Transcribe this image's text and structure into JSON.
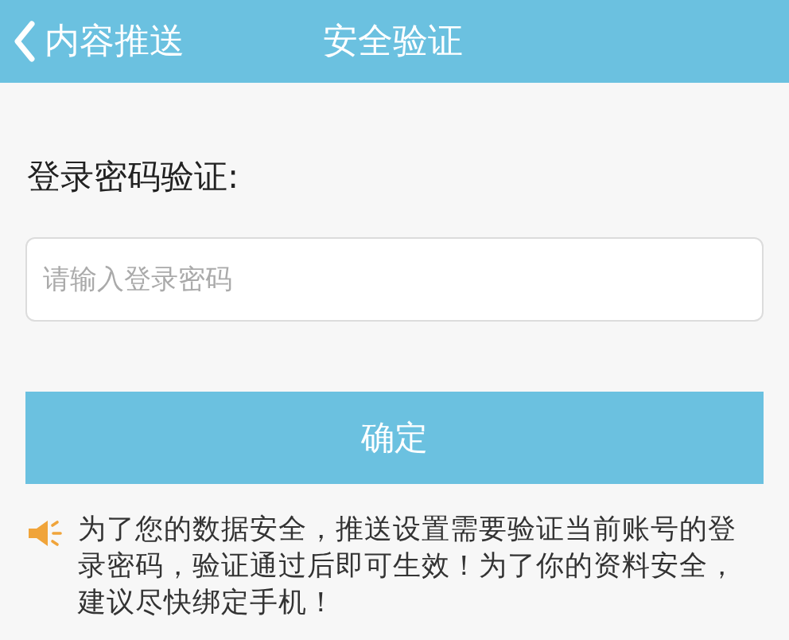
{
  "header": {
    "back_label": "内容推送",
    "title": "安全验证"
  },
  "form": {
    "label": "登录密码验证:",
    "password": {
      "placeholder": "请输入登录密码"
    },
    "submit": "确定"
  },
  "notice": {
    "text": "为了您的数据安全，推送设置需要验证当前账号的登录密码，验证通过后即可生效！为了你的资料安全，建议尽快绑定手机！"
  }
}
